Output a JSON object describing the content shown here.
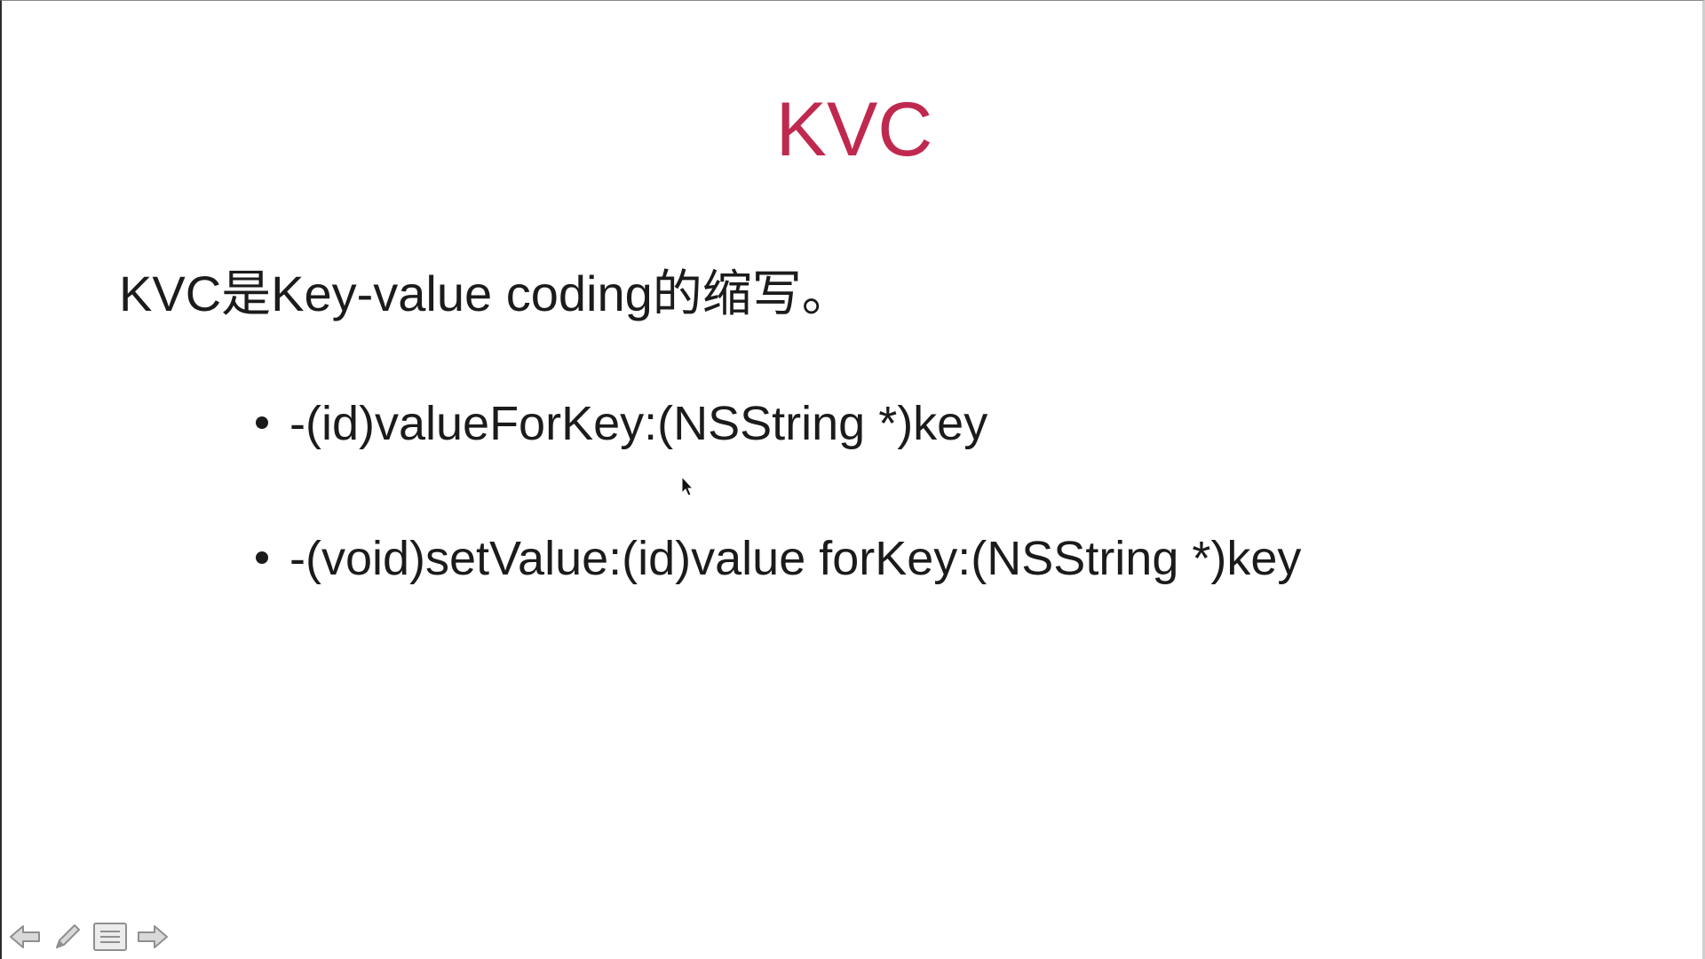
{
  "slide": {
    "title": "KVC",
    "title_color": "#c0294f",
    "intro": "KVC是Key-value coding的缩写。",
    "bullets": [
      {
        "text": "-(id)valueForKey:(NSString *)key"
      },
      {
        "text": "-(void)setValue:(id)value forKey:(NSString *)key"
      }
    ]
  },
  "toolbar": {
    "items": [
      {
        "icon": "arrow-left-icon"
      },
      {
        "icon": "pen-icon"
      },
      {
        "icon": "menu-icon"
      },
      {
        "icon": "arrow-right-icon"
      }
    ]
  },
  "cursor": {
    "icon": "mouse-pointer-icon"
  }
}
